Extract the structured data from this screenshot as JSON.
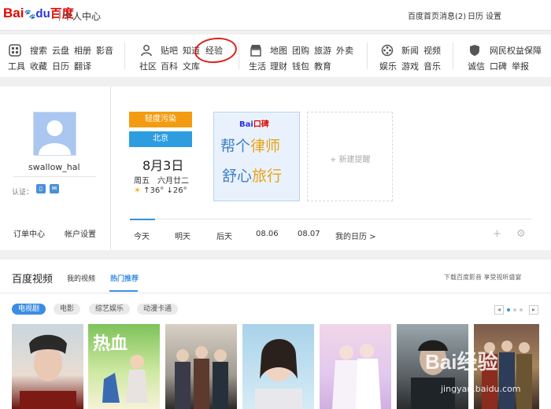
{
  "header": {
    "logo": {
      "bai": "Bai",
      "du": "du",
      "cn": "百度"
    },
    "title": "个人中心",
    "links": [
      "百度首页",
      "消息(2)",
      "日历",
      "设置"
    ]
  },
  "services": {
    "groups": [
      {
        "icon": "grid-icon",
        "items": [
          [
            "搜索",
            "云盘",
            "相册",
            "影音"
          ],
          [
            "工具",
            "收藏",
            "日历",
            "翻译"
          ]
        ]
      },
      {
        "icon": "person-icon",
        "items": [
          [
            "贴吧",
            "知道",
            "经验"
          ],
          [
            "社区",
            "百科",
            "文库"
          ]
        ]
      },
      {
        "icon": "shop-icon",
        "items": [
          [
            "地图",
            "团购",
            "旅游",
            "外卖"
          ],
          [
            "生活",
            "理财",
            "钱包",
            "教育"
          ]
        ]
      },
      {
        "icon": "film-reel-icon",
        "items": [
          [
            "新闻",
            "视频"
          ],
          [
            "娱乐",
            "游戏",
            "音乐"
          ]
        ]
      },
      {
        "icon": "shield-icon",
        "items": [
          [
            "网民权益保障"
          ],
          [
            "诚信",
            "口碑",
            "举报"
          ]
        ]
      }
    ]
  },
  "profile": {
    "username": "swallow_hal",
    "auth_label": "认证：",
    "order_link": "订单中心",
    "account_link": "帐户设置"
  },
  "weather": {
    "level": "轻度污染",
    "city": "北京",
    "date": "8月3日",
    "weekday": "周五",
    "lunar": "六月廿二",
    "high": "36°",
    "low": "26°"
  },
  "banner": {
    "brand_bai": "Bai",
    "brand_rest": "口碑",
    "line1_a": "帮个",
    "line1_b": "律师",
    "line2_a": "舒心",
    "line2_b": "旅行"
  },
  "reminder": {
    "label": "+ 新建提醒"
  },
  "day_tabs": [
    "今天",
    "明天",
    "后天",
    "08.06",
    "08.07",
    "我的日历 >"
  ],
  "video": {
    "title": "百度视频",
    "tab_mine": "我的视频",
    "tab_hot": "热门推荐",
    "download": "下载百度影音 享受视听盛宴",
    "categories": [
      "电视剧",
      "电影",
      "综艺娱乐",
      "动漫卡通"
    ],
    "pager_prev": "◂",
    "pager_next": "▸"
  },
  "watermark": {
    "line1": "Bai经验",
    "line2": "jingyan.baidu.com"
  },
  "colors": {
    "accent": "#3c8de2",
    "brand_red": "#e10601",
    "brand_blue": "#2932e1",
    "pollution": "#f39c12"
  }
}
